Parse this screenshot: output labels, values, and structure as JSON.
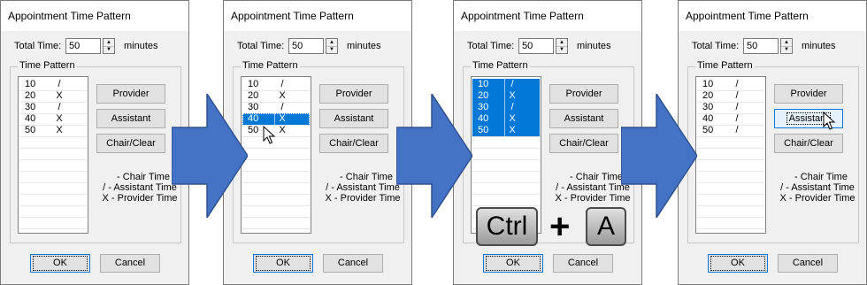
{
  "dialog": {
    "title": "Appointment Time Pattern",
    "total_time_label": "Total Time:",
    "total_time_value": "50",
    "minutes_label": "minutes",
    "group_label": "Time Pattern",
    "buttons": {
      "provider": "Provider",
      "assistant": "Assistant",
      "chair_clear": "Chair/Clear",
      "ok": "OK",
      "cancel": "Cancel"
    },
    "legend": [
      "- Chair Time",
      "/ - Assistant Time",
      "X - Provider Time"
    ]
  },
  "panels": [
    {
      "step": 1,
      "rows": [
        {
          "time": "10",
          "mark": "/",
          "selected": false
        },
        {
          "time": "20",
          "mark": "X",
          "selected": false
        },
        {
          "time": "30",
          "mark": "/",
          "selected": false
        },
        {
          "time": "40",
          "mark": "X",
          "selected": false
        },
        {
          "time": "50",
          "mark": "X",
          "selected": false
        }
      ]
    },
    {
      "step": 2,
      "rows": [
        {
          "time": "10",
          "mark": "/",
          "selected": false
        },
        {
          "time": "20",
          "mark": "X",
          "selected": false
        },
        {
          "time": "30",
          "mark": "/",
          "selected": false
        },
        {
          "time": "40",
          "mark": "X",
          "selected": true
        },
        {
          "time": "50",
          "mark": "X",
          "selected": false
        }
      ]
    },
    {
      "step": 3,
      "rows": [
        {
          "time": "10",
          "mark": "/",
          "selected": true
        },
        {
          "time": "20",
          "mark": "X",
          "selected": true
        },
        {
          "time": "30",
          "mark": "/",
          "selected": true
        },
        {
          "time": "40",
          "mark": "X",
          "selected": true
        },
        {
          "time": "50",
          "mark": "X",
          "selected": true
        }
      ]
    },
    {
      "step": 4,
      "rows": [
        {
          "time": "10",
          "mark": "/",
          "selected": false
        },
        {
          "time": "20",
          "mark": "/",
          "selected": false
        },
        {
          "time": "30",
          "mark": "/",
          "selected": false
        },
        {
          "time": "40",
          "mark": "/",
          "selected": false
        },
        {
          "time": "50",
          "mark": "/",
          "selected": false
        }
      ]
    }
  ],
  "keyboard": {
    "key1": "Ctrl",
    "plus": "+",
    "key2": "A"
  },
  "colors": {
    "arrow": "#4472c4",
    "selection": "#0078d7",
    "dialog_bg": "#f0f0f0"
  }
}
